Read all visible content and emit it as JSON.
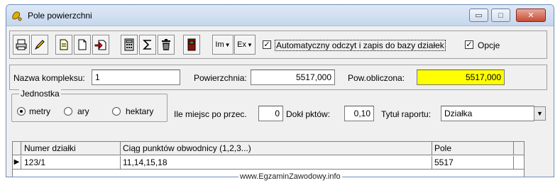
{
  "window": {
    "title": "Pole powierzchni",
    "controls": {
      "minimize": "▭",
      "maximize": "□",
      "close": "✕"
    }
  },
  "toolbar": {
    "buttons": [
      {
        "icon": "printer-icon"
      },
      {
        "icon": "pencil-icon"
      },
      {
        "icon": "copy-document-icon"
      },
      {
        "icon": "new-document-icon"
      },
      {
        "icon": "import-document-icon"
      },
      {
        "icon": "calculator-icon"
      },
      {
        "icon": "sum-icon"
      },
      {
        "icon": "trash-icon"
      },
      {
        "icon": "exit-door-icon"
      }
    ],
    "im_label": "Im",
    "ex_label": "Ex",
    "auto_checkbox_label": "Automatyczny odczyt i zapis do bazy działek",
    "auto_checked": true,
    "options_label": "Opcje",
    "options_checked": true
  },
  "complex": {
    "name_label": "Nazwa kompleksu:",
    "name_value": "1",
    "area_label": "Powierzchnia:",
    "area_value": "5517,000",
    "calc_label": "Pow.obliczona:",
    "calc_value": "5517,000",
    "calc_color": "#ffff00"
  },
  "units": {
    "group_label": "Jednostka",
    "options": [
      "metry",
      "ary",
      "hektary"
    ],
    "selected": "metry"
  },
  "settings": {
    "decimals_label": "Ile miejsc po przec.",
    "decimals_value": "0",
    "precision_label": "Dokł pktów:",
    "precision_value": "0,10",
    "report_label": "Tytuł raportu:",
    "report_value": "Działka"
  },
  "table": {
    "columns": [
      "Numer działki",
      "Ciąg punktów obwodnicy (1,2,3...)",
      "Pole"
    ],
    "rows": [
      [
        "123/1",
        "11,14,15,18",
        "5517"
      ]
    ]
  },
  "watermark": "www.EgzaminZawodowy.info"
}
